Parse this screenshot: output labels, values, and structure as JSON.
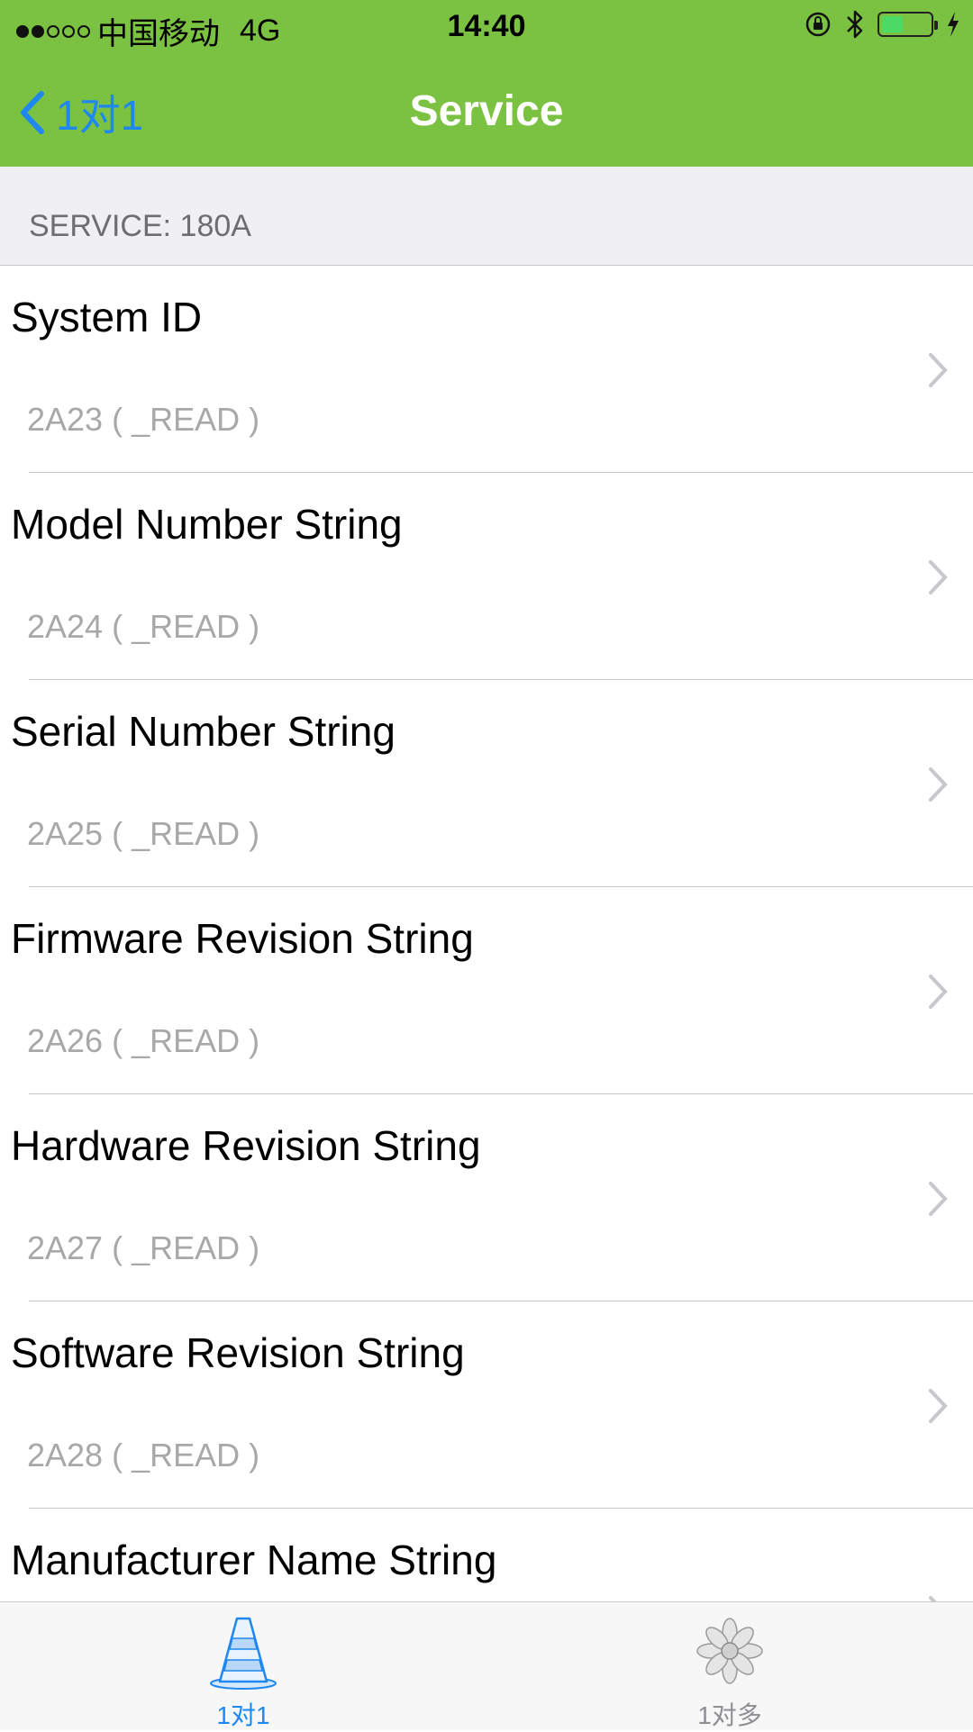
{
  "status_bar": {
    "carrier": "中国移动",
    "network": "4G",
    "time": "14:40"
  },
  "nav": {
    "back_label": "1对1",
    "title": "Service"
  },
  "section": {
    "header": "SERVICE: 180A"
  },
  "characteristics": [
    {
      "name": "System ID",
      "detail": "2A23 ( _READ )"
    },
    {
      "name": "Model Number String",
      "detail": "2A24 ( _READ )"
    },
    {
      "name": "Serial Number String",
      "detail": "2A25 ( _READ )"
    },
    {
      "name": "Firmware Revision String",
      "detail": "2A26 ( _READ )"
    },
    {
      "name": "Hardware Revision String",
      "detail": "2A27 ( _READ )"
    },
    {
      "name": "Software Revision String",
      "detail": "2A28 ( _READ )"
    },
    {
      "name": "Manufacturer Name String",
      "detail": ""
    }
  ],
  "tabs": [
    {
      "label": "1对1",
      "icon": "traffic-cone-icon",
      "active": true
    },
    {
      "label": "1对多",
      "icon": "flower-icon",
      "active": false
    }
  ],
  "colors": {
    "bar": "#7bc142",
    "accent": "#1e88f0",
    "section_bg": "#efeff4",
    "detail_text": "#a8a8a8"
  }
}
